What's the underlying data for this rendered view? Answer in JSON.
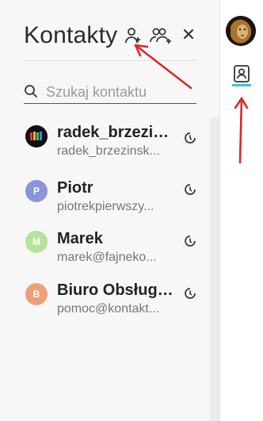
{
  "panel": {
    "title": "Kontakty",
    "add_contact_icon": "person-add-icon",
    "add_group_icon": "group-add-icon",
    "close_icon": "close-icon"
  },
  "search": {
    "placeholder": "Szukaj kontaktu",
    "icon": "search-icon"
  },
  "contacts": [
    {
      "name": "radek_brzezin...",
      "sub": "radek_brzezinsk...",
      "avatar_letter": "",
      "avatar_color": "#111111",
      "status_icon": "status-offline-icon"
    },
    {
      "name": "Piotr",
      "sub": "piotrekpierwszy...",
      "avatar_letter": "P",
      "avatar_color": "#8a94de",
      "status_icon": "status-offline-icon"
    },
    {
      "name": "Marek",
      "sub": "marek@fajneko...",
      "avatar_letter": "M",
      "avatar_color": "#b6e39a",
      "status_icon": "status-offline-icon"
    },
    {
      "name": "Biuro Obsługi ...",
      "sub": "pomoc@kontakt...",
      "avatar_letter": "B",
      "avatar_color": "#ef9f78",
      "status_icon": "status-offline-icon"
    }
  ],
  "side": {
    "user_avatar": "user-avatar",
    "contacts_tab_icon": "contacts-book-icon",
    "accent": "#37c6d6"
  },
  "annotation_color": "#d42a2a"
}
